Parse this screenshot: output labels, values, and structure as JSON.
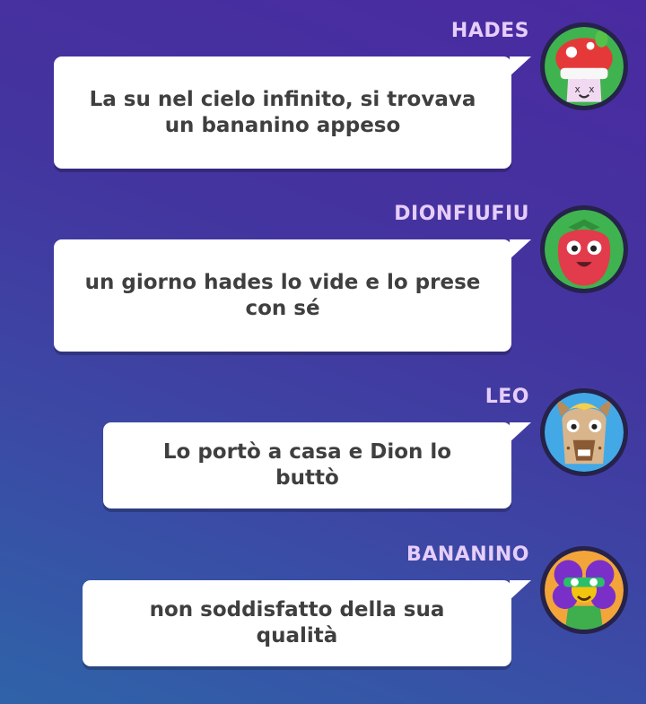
{
  "messages": [
    {
      "name": "HADES",
      "text": "La su nel cielo infinito, si trovava un bananino appeso",
      "avatar_icon": "mushroom-avatar-icon"
    },
    {
      "name": "DIONFIUFIU",
      "text": "un giorno hades lo vide e lo prese con sé",
      "avatar_icon": "strawberry-avatar-icon"
    },
    {
      "name": "LEO",
      "text": "Lo portò a casa e Dion lo buttò",
      "avatar_icon": "llama-avatar-icon"
    },
    {
      "name": "BANANINO",
      "text": "non soddisfatto della sua qualità",
      "avatar_icon": "flower-avatar-icon"
    }
  ],
  "colors": {
    "name": "#e6cdfb",
    "bubble": "#ffffff",
    "text": "#3f3f3f"
  }
}
